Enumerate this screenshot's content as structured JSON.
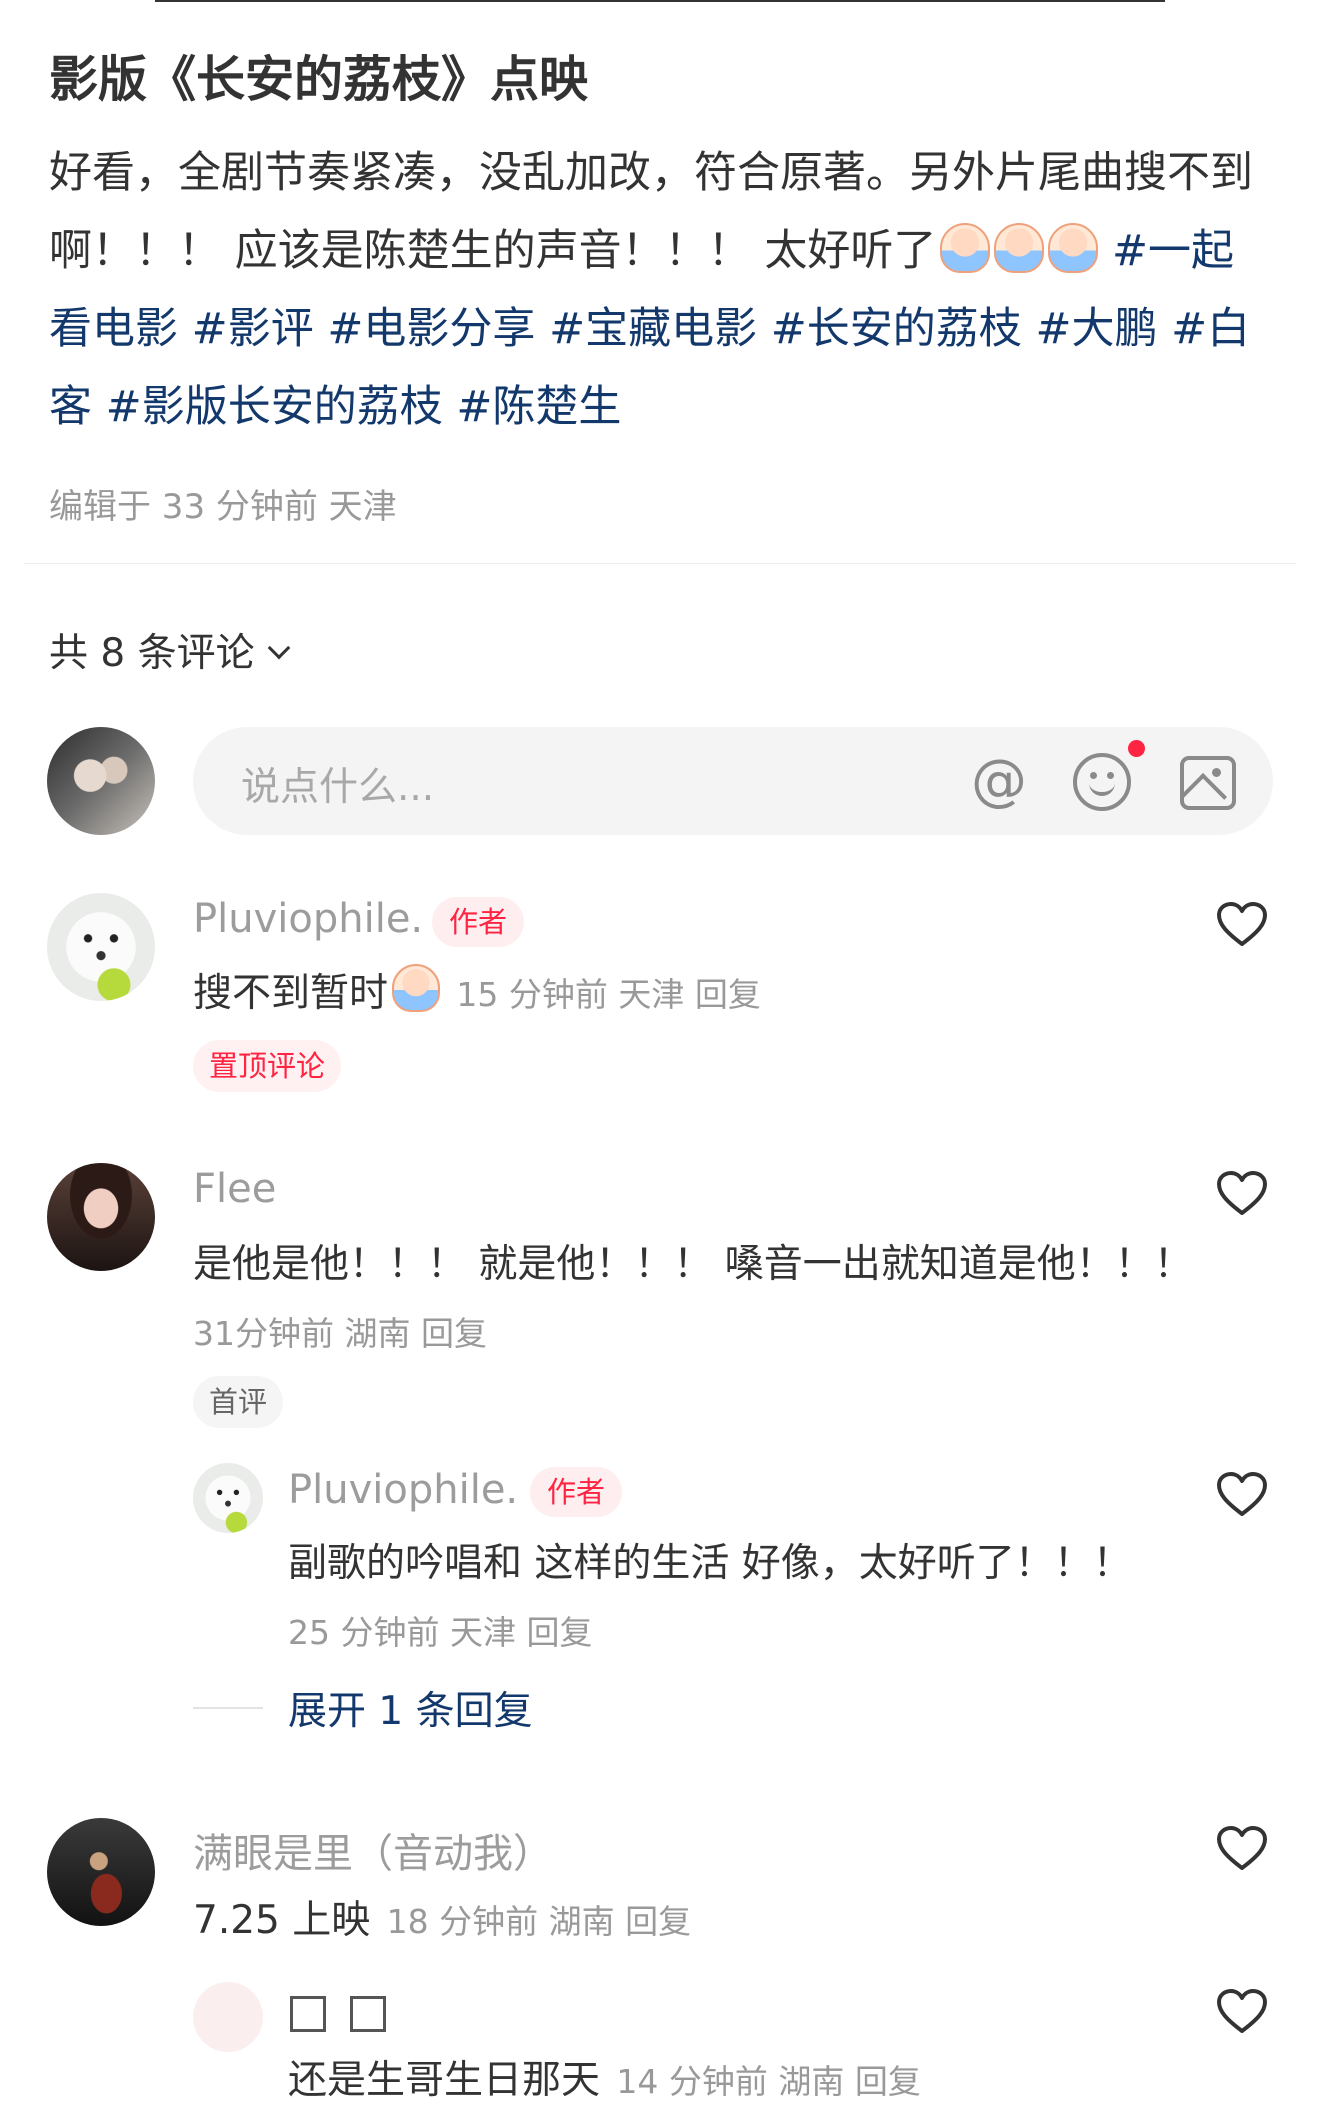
{
  "post": {
    "title": "影版《长安的荔枝》点映",
    "body_text": "好看，全剧节奏紧凑，没乱加改，符合原著。另外片尾曲搜不到啊！！！ 应该是陈楚生的声音！！！ 太好听了",
    "hashtags": "#一起看电影 #影评 #电影分享 #宝藏电影 #长安的荔枝 #大鹏 #白客 #影版长安的荔枝 #陈楚生",
    "meta": "编辑于 33 分钟前 天津"
  },
  "comments_header": {
    "label": "共 8 条评论"
  },
  "input": {
    "placeholder": "说点什么..."
  },
  "comments": [
    {
      "author": "Pluviophile.",
      "badge": "作者",
      "text": "搜不到暂时",
      "meta": "15 分钟前 天津 回复",
      "tag": "置顶评论"
    },
    {
      "author": "Flee",
      "text": "是他是他！！！ 就是他！！！ 嗓音一出就知道是他！！！",
      "meta": "31分钟前 湖南 回复",
      "tag": "首评",
      "replies": [
        {
          "author": "Pluviophile.",
          "badge": "作者",
          "text": "副歌的吟唱和 这样的生活 好像，太好听了！！！",
          "meta": "25 分钟前 天津 回复"
        }
      ],
      "expand_label": "展开 1 条回复"
    },
    {
      "author": "满眼是里（音动我）",
      "text": "7.25 上映",
      "meta": "18 分钟前 湖南 回复",
      "replies": [
        {
          "author": "",
          "text": "还是生哥生日那天",
          "meta": "14 分钟前 湖南 回复"
        }
      ]
    }
  ],
  "icons": [
    "at-icon",
    "emoji-icon",
    "image-icon",
    "heart-icon",
    "chevron-down-icon"
  ],
  "colors": {
    "accent": "#ff2442",
    "hashtag": "#13386c",
    "meta": "#999999"
  }
}
